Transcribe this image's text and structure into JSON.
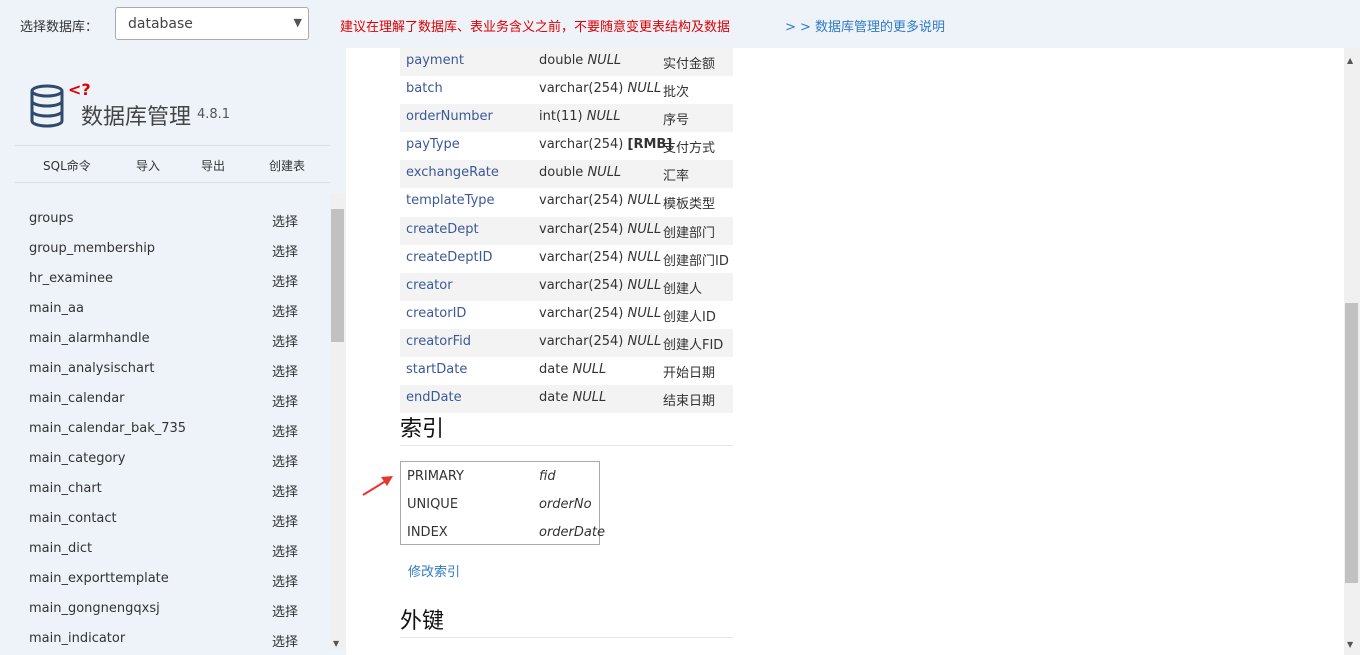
{
  "topbar": {
    "db_label": "选择数据库：",
    "db_selected": "database",
    "warning": "建议在理解了数据库、表业务含义之前，不要随意变更表结构及数据",
    "more_link": "> > 数据库管理的更多说明"
  },
  "sidebar": {
    "title": "数据库管理",
    "version": "4.8.1",
    "nav": [
      "SQL命令",
      "导入",
      "导出",
      "创建表"
    ],
    "select_label": "选择",
    "tables": [
      "groups",
      "group_membership",
      "hr_examinee",
      "main_aa",
      "main_alarmhandle",
      "main_analysischart",
      "main_calendar",
      "main_calendar_bak_735",
      "main_category",
      "main_chart",
      "main_contact",
      "main_dict",
      "main_exporttemplate",
      "main_gongnengqxsj",
      "main_indicator"
    ]
  },
  "fields": [
    {
      "name": "payment",
      "type": "double",
      "default": "NULL",
      "comment": "实付金额"
    },
    {
      "name": "batch",
      "type": "varchar(254)",
      "default": "NULL",
      "comment": "批次"
    },
    {
      "name": "orderNumber",
      "type": "int(11)",
      "default": "NULL",
      "comment": "序号"
    },
    {
      "name": "payType",
      "type": "varchar(254)",
      "default": "[RMB]",
      "comment": "支付方式"
    },
    {
      "name": "exchangeRate",
      "type": "double",
      "default": "NULL",
      "comment": "汇率"
    },
    {
      "name": "templateType",
      "type": "varchar(254)",
      "default": "NULL",
      "comment": "模板类型"
    },
    {
      "name": "createDept",
      "type": "varchar(254)",
      "default": "NULL",
      "comment": "创建部门"
    },
    {
      "name": "createDeptID",
      "type": "varchar(254)",
      "default": "NULL",
      "comment": "创建部门ID"
    },
    {
      "name": "creator",
      "type": "varchar(254)",
      "default": "NULL",
      "comment": "创建人"
    },
    {
      "name": "creatorID",
      "type": "varchar(254)",
      "default": "NULL",
      "comment": "创建人ID"
    },
    {
      "name": "creatorFid",
      "type": "varchar(254)",
      "default": "NULL",
      "comment": "创建人FID"
    },
    {
      "name": "startDate",
      "type": "date",
      "default": "NULL",
      "comment": "开始日期"
    },
    {
      "name": "endDate",
      "type": "date",
      "default": "NULL",
      "comment": "结束日期"
    }
  ],
  "indexes_section": {
    "heading": "索引",
    "rows": [
      {
        "type": "PRIMARY",
        "column": "fid"
      },
      {
        "type": "UNIQUE",
        "column": "orderNo"
      },
      {
        "type": "INDEX",
        "column": "orderDate"
      }
    ],
    "edit_link": "修改索引"
  },
  "fk_section": {
    "heading": "外键"
  },
  "colors": {
    "accent": "#2f7ac9",
    "warning": "#e00000",
    "field_name": "#3b5998",
    "arrow": "#e8362d"
  }
}
